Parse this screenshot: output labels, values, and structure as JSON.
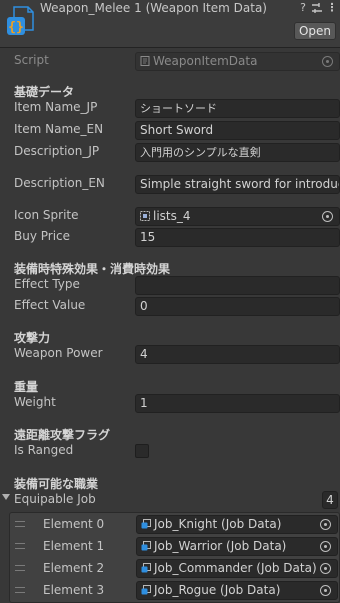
{
  "header": {
    "title": "Weapon_Melee 1 (Weapon Item Data)",
    "open_label": "Open",
    "icons": [
      "help-icon",
      "preset-icon",
      "more-icon"
    ]
  },
  "script": {
    "label": "Script",
    "value": "WeaponItemData"
  },
  "sections": {
    "basic": "基礎データ",
    "effect": "装備時特殊効果・消費時効果",
    "attack": "攻撃力",
    "weight": "重量",
    "ranged": "遠距離攻撃フラグ",
    "equipable": "装備可能な職業"
  },
  "fields": {
    "item_name_jp": {
      "label": "Item Name_JP",
      "value": "ショートソード"
    },
    "item_name_en": {
      "label": "Item Name_EN",
      "value": "Short Sword"
    },
    "description_jp": {
      "label": "Description_JP",
      "value": "入門用のシンプルな直剣"
    },
    "description_en": {
      "label": "Description_EN",
      "value": "Simple straight sword for introduct"
    },
    "icon_sprite": {
      "label": "Icon Sprite",
      "value": "lists_4"
    },
    "buy_price": {
      "label": "Buy Price",
      "value": "15"
    },
    "effect_type": {
      "label": "Effect Type",
      "value": ""
    },
    "effect_value": {
      "label": "Effect Value",
      "value": "0"
    },
    "weapon_power": {
      "label": "Weapon Power",
      "value": "4"
    },
    "weight": {
      "label": "Weight",
      "value": "1"
    },
    "is_ranged": {
      "label": "Is Ranged",
      "checked": false
    }
  },
  "equipable_job": {
    "label": "Equipable Job",
    "count": "4",
    "elements": [
      {
        "label": "Element 0",
        "value": "Job_Knight (Job Data)"
      },
      {
        "label": "Element 1",
        "value": "Job_Warrior (Job Data)"
      },
      {
        "label": "Element 2",
        "value": "Job_Commander (Job Data)"
      },
      {
        "label": "Element 3",
        "value": "Job_Rogue (Job Data)"
      }
    ]
  },
  "colors": {
    "background": "#383838",
    "field": "#2a2a2a",
    "asset_icon": "#2f8fe0",
    "asset_icon_accent": "#f0a020"
  }
}
